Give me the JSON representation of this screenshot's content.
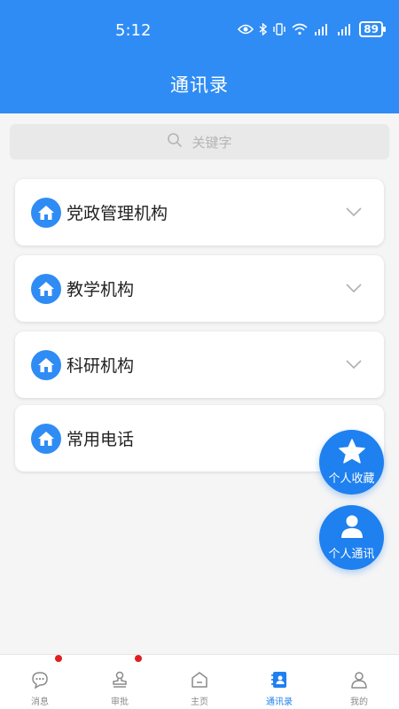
{
  "status": {
    "time": "5:12",
    "battery": "89"
  },
  "header": {
    "title": "通讯录"
  },
  "search": {
    "placeholder": "关键字"
  },
  "groups": [
    {
      "label": "党政管理机构"
    },
    {
      "label": "教学机构"
    },
    {
      "label": "科研机构"
    },
    {
      "label": "常用电话"
    }
  ],
  "fabs": {
    "favorites": "个人收藏",
    "personal": "个人通讯"
  },
  "tabs": [
    {
      "label": "消息"
    },
    {
      "label": "审批"
    },
    {
      "label": "主页"
    },
    {
      "label": "通讯录"
    },
    {
      "label": "我的"
    }
  ],
  "colors": {
    "primary": "#2f8cf4",
    "badge": "#e02020"
  }
}
